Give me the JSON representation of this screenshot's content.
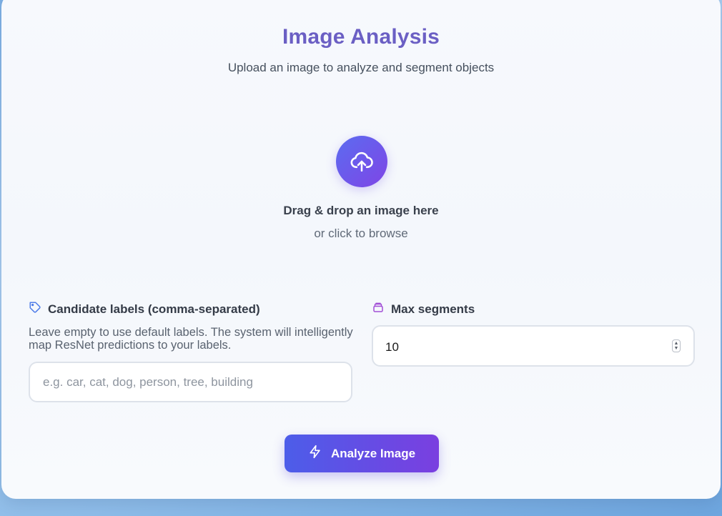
{
  "header": {
    "title": "Image Analysis",
    "subtitle": "Upload an image to analyze and segment objects"
  },
  "dropzone": {
    "icon": "cloud-upload-icon",
    "main_text": "Drag & drop an image here",
    "sub_text": "or click to browse"
  },
  "labels": {
    "icon": "tag-icon",
    "heading": "Candidate labels (comma-separated)",
    "helper": "Leave empty to use default labels. The system will intelligently map ResNet predictions to your labels.",
    "placeholder": "e.g. car, cat, dog, person, tree, building",
    "value": ""
  },
  "max_segments": {
    "icon": "layers-icon",
    "heading": "Max segments",
    "value": "10"
  },
  "actions": {
    "analyze_icon": "lightning-icon",
    "analyze_label": "Analyze Image"
  },
  "colors": {
    "title": "#6b5fc4",
    "accent_start": "#4c5de9",
    "accent_end": "#7a3fe0"
  }
}
